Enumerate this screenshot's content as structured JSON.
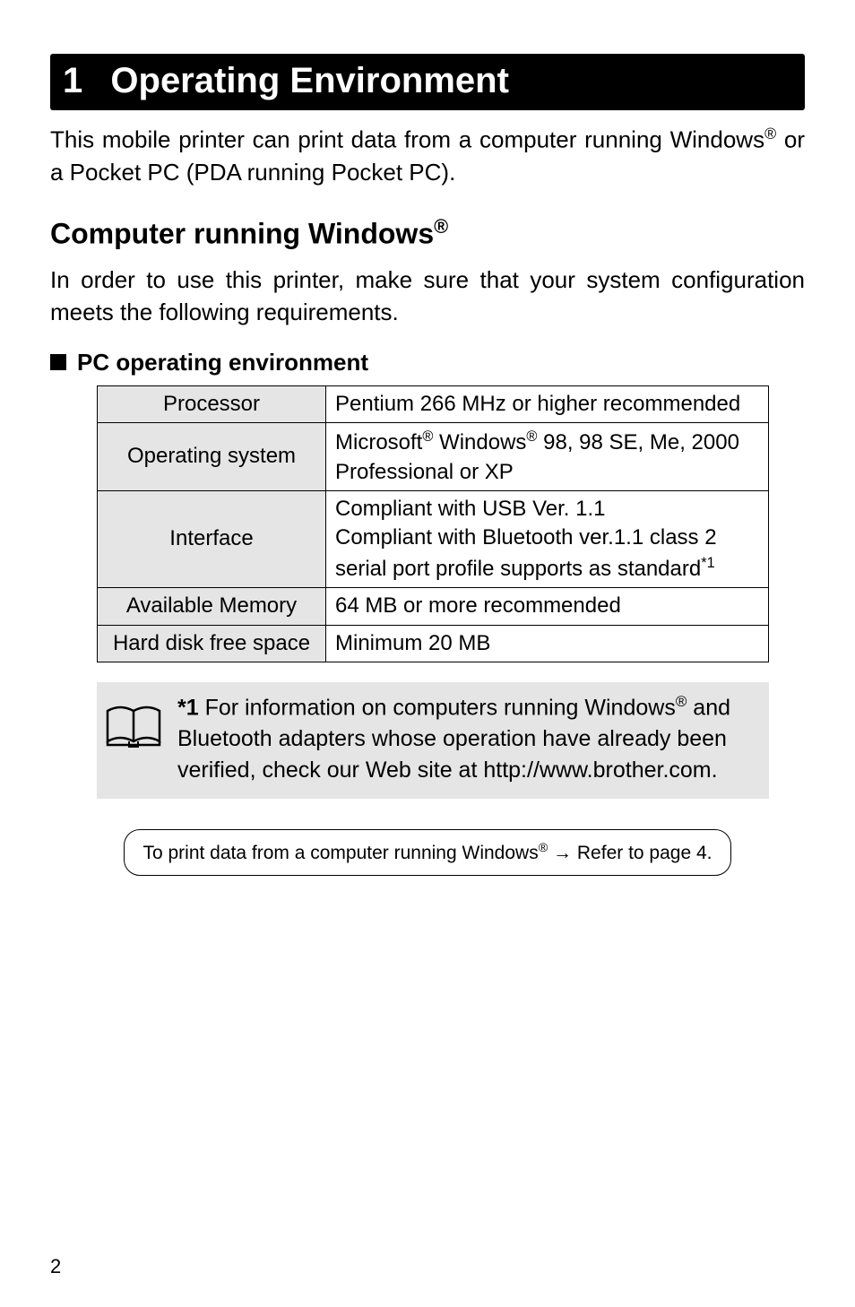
{
  "chapter": {
    "number": "1",
    "title": "Operating Environment"
  },
  "intro": "This mobile printer can print data from a computer running Windows",
  "intro_suffix": " or a Pocket PC (PDA running Pocket PC).",
  "section": {
    "title_prefix": "Computer running Windows",
    "body": "In order to use this printer, make sure that your system configuration meets the following requirements."
  },
  "subsection": {
    "title": "PC operating environment"
  },
  "table": {
    "rows": [
      {
        "label": "Processor",
        "value": "Pentium 266 MHz or higher recommended"
      },
      {
        "label": "Operating system",
        "value_prefix": "Microsoft",
        "value_mid": " Windows",
        "value_suffix": " 98, 98 SE, Me, 2000 Professional or XP"
      },
      {
        "label": "Interface",
        "line1": "Compliant with USB Ver. 1.1",
        "line2": "Compliant with Bluetooth ver.1.1 class 2 serial port profile supports as standard",
        "line2_sup": "*1"
      },
      {
        "label": "Available Memory",
        "value": "64 MB or more recommended"
      },
      {
        "label": "Hard disk free space",
        "value": "Minimum 20 MB"
      }
    ]
  },
  "note": {
    "marker": "*1",
    "text_prefix": " For information on computers running Windows",
    "text_suffix": " and Bluetooth adapters whose operation have already been verified, check our Web site at http://www.brother.com."
  },
  "refbox": {
    "prefix": "To print data from a computer running Windows",
    "suffix": " → Refer to page 4."
  },
  "page_number": "2",
  "reg_mark": "®"
}
